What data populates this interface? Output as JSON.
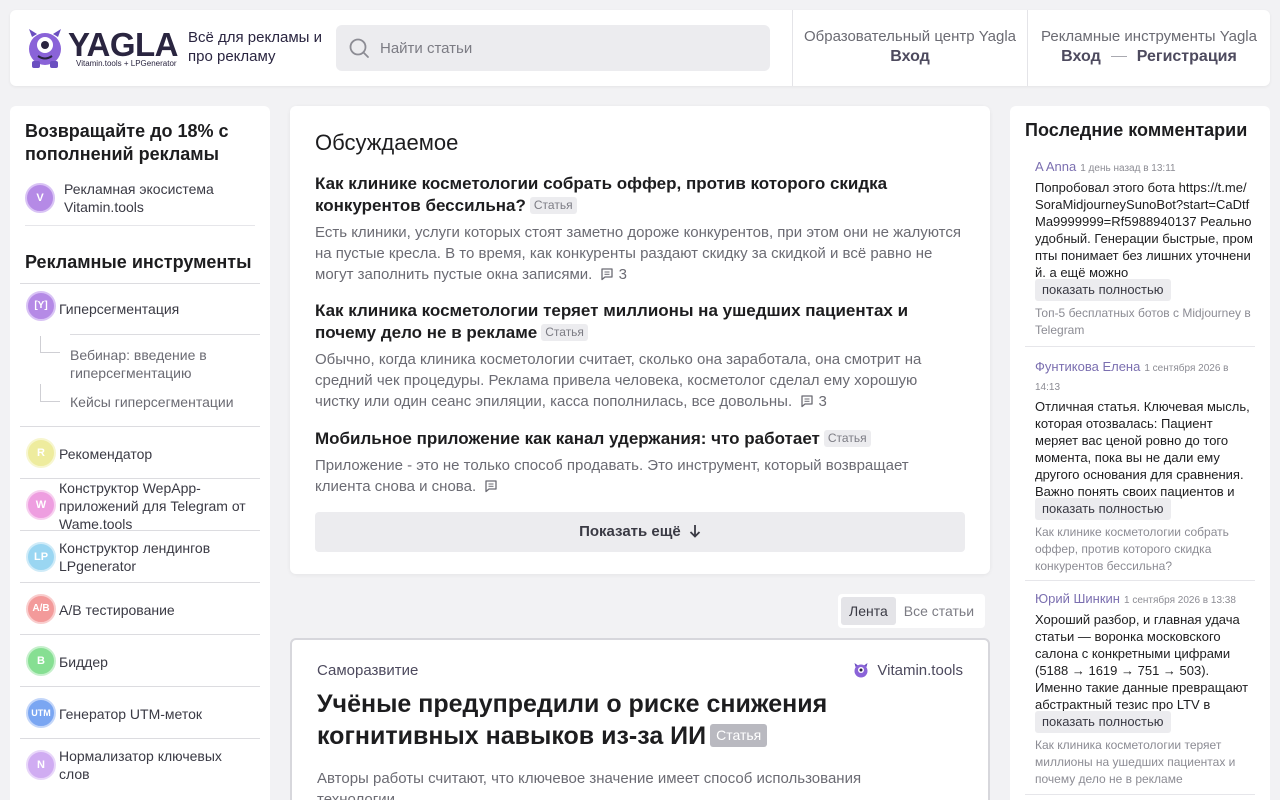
{
  "header": {
    "logo_text": "YAGLA",
    "logo_sub": "Vitamin.tools + LPGenerator",
    "tagline": "Всё для рекламы и про рекламу",
    "search_placeholder": "Найти статьи",
    "edu": {
      "title": "Образовательный центр Yagla",
      "login": "Вход"
    },
    "tools": {
      "title": "Рекламные инструменты Yagla",
      "login": "Вход",
      "register": "Регистрация"
    }
  },
  "left": {
    "promo_title": "Возвращайте до 18% с пополнений рекламы",
    "ecosystem": {
      "badge": "V",
      "label": "Рекламная экосистема Vitamin.tools",
      "color": "#a97be0"
    },
    "tools_title": "Рекламные инструменты",
    "tools": [
      {
        "badge": "[Y]",
        "label": "Гиперсегментация",
        "color": "#a97be0"
      },
      {
        "badge": "R",
        "label": "Рекомендатор",
        "color": "#e6e48a"
      },
      {
        "badge": "W",
        "label": "Конструктор WepApp-приложений для Telegram от Wame.tools",
        "color": "#e893d9"
      },
      {
        "badge": "LP",
        "label": "Конструктор лендингов LPgenerator",
        "color": "#8fd1f0"
      },
      {
        "badge": "A/B",
        "label": "A/B тестирование",
        "color": "#f08a8a"
      },
      {
        "badge": "B",
        "label": "Биддер",
        "color": "#7fdc8c"
      },
      {
        "badge": "UTM",
        "label": "Генератор UTM-меток",
        "color": "#6f9ef0"
      },
      {
        "badge": "N",
        "label": "Нормализатор ключевых слов",
        "color": "#c9a6f0"
      }
    ],
    "subitems": [
      "Вебинар: введение в гиперсегментацию",
      "Кейсы гиперсегментации"
    ]
  },
  "discussed": {
    "title": "Обсуждаемое",
    "tag": "Статья",
    "articles": [
      {
        "title": "Как клинике косметологии собрать оффер, против которого скидка конкурентов бессильна?",
        "text": "Есть клиники, услуги которых стоят заметно дороже конкурентов, при этом они не жалуются на пустые кресла. В то время, как конкуренты раздают скидку за скидкой и всё равно не могут заполнить пустые окна записями.",
        "comments": "3"
      },
      {
        "title": "Как клиника косметологии теряет миллионы на ушедших пациентах и почему дело не в рекламе",
        "text": "Обычно, когда клиника косметологии считает, сколько она заработала, она смотрит на средний чек процедуры. Реклама привела человека, косметолог сделал ему хорошую чистку или один сеанс эпиляции, касса пополнилась, все довольны.",
        "comments": "3"
      },
      {
        "title": "Мобильное приложение как канал удержания: что работает",
        "text": "Приложение - это не только способ продавать. Это инструмент, который возвращает клиента снова и снова.",
        "comments": ""
      }
    ],
    "more": "Показать ещё"
  },
  "feed_tabs": [
    "Лента",
    "Все статьи"
  ],
  "feature": {
    "category": "Саморазвитие",
    "source": "Vitamin.tools",
    "title": "Учёные предупредили о риске снижения когнитивных навыков из-за ИИ",
    "tag": "Статья",
    "text": "Авторы работы считают, что ключевое значение имеет способ использования технологии."
  },
  "right": {
    "title": "Последние комментарии",
    "show_full": "показать полностью",
    "comments": [
      {
        "author": "A Anna",
        "time": "1 день назад в 13:11",
        "text": "Попробовал этого бота https://t.me/SoraMidjourneySunoBot?start=CaDtfMa9999999=Rf5988940137 Реально удобный. Генерации быстрые, промпты понимает без лишних уточнений. а ещё можно",
        "article": "Топ-5 бесплатных ботов с Midjourney в Telegram"
      },
      {
        "author": "Фунтикова Елена",
        "time": "1 сентября 2026 в 14:13",
        "text": "Отличная статья. Ключевая мысль, которая отозвалась: Пациент меряет вас ценой ровно до того момента, пока вы не дали ему другого основания для сравнения. Важно понять своих пациентов и",
        "article": "Как клинике косметологии собрать оффер, против которого скидка конкурентов бессильна?"
      },
      {
        "author": "Юрий Шинкин",
        "time": "1 сентября 2026 в 13:38",
        "text": "Хороший разбор, и главная удача статьи — воронка московского салона с конкретными цифрами (5188 → 1619 → 751 → 503). Именно такие данные превращают абстрактный тезис про LTV в",
        "article": "Как клиника косметологии теряет миллионы на ушедших пациентах и почему дело не в рекламе"
      }
    ]
  }
}
